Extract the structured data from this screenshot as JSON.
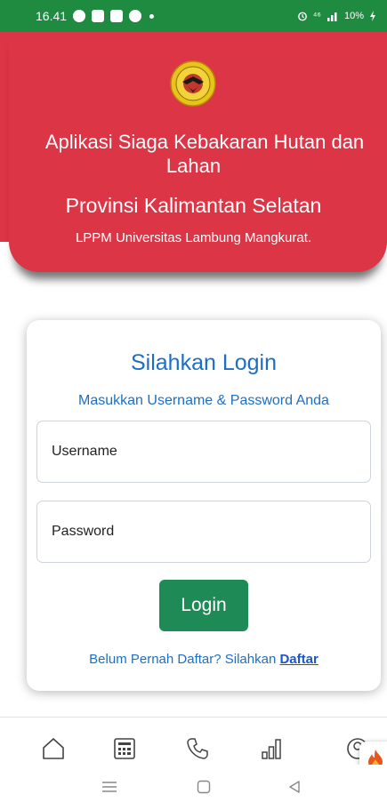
{
  "status_bar": {
    "time": "16.41",
    "network": "⁴⁶",
    "battery": "10%"
  },
  "header": {
    "title_line1": "Aplikasi Siaga Kebakaran Hutan dan",
    "title_line2": "Lahan",
    "subtitle": "Provinsi Kalimantan Selatan",
    "org": "LPPM Universitas Lambung Mangkurat.",
    "color": "#dc3545"
  },
  "login": {
    "title": "Silahkan Login",
    "subtitle": "Masukkan Username & Password Anda",
    "username_placeholder": "Username",
    "password_placeholder": "Password",
    "button_label": "Login",
    "register_prompt": "Belum Pernah Daftar? Silahkan",
    "register_link": "Daftar",
    "accent_color": "#1e6fc2",
    "button_color": "#1e8a55"
  },
  "bottom_nav": {
    "items": [
      {
        "icon": "home-icon"
      },
      {
        "icon": "calculator-icon"
      },
      {
        "icon": "phone-icon"
      },
      {
        "icon": "signal-bars-icon"
      },
      {
        "icon": "user-icon"
      }
    ],
    "fab_icon": "fire-icon"
  },
  "system_nav": {
    "items": [
      "menu-icon",
      "home-square-icon",
      "back-triangle-icon"
    ]
  }
}
